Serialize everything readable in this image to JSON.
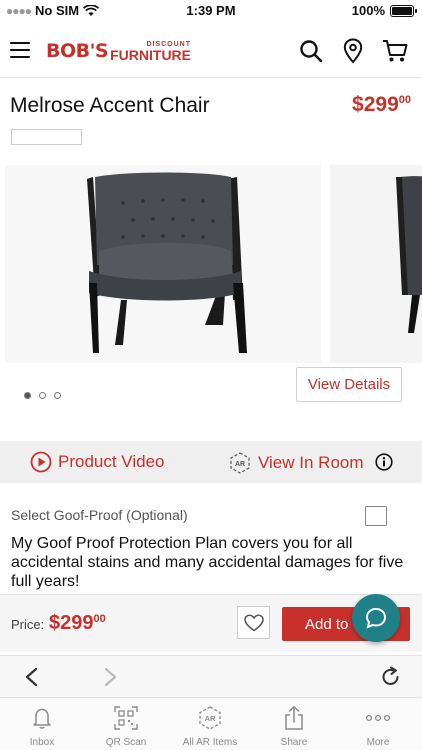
{
  "status": {
    "carrier": "No SIM",
    "time": "1:39 PM",
    "battery": "100%"
  },
  "header": {
    "logo_main": "BOB'S",
    "logo_small": "DISCOUNT",
    "logo_sub": "FURNITURE",
    "icons": [
      "menu-icon",
      "search-icon",
      "location-icon",
      "cart-icon"
    ]
  },
  "product": {
    "title": "Melrose Accent Chair",
    "price_dollars": "$299",
    "price_cents": "00",
    "images_count": 3,
    "active_image": 1,
    "view_details_label": "View Details"
  },
  "media": {
    "product_video_label": "Product Video",
    "view_in_room_label": "View In Room",
    "ar_badge": "AR"
  },
  "goof": {
    "label": "Select Goof-Proof (Optional)",
    "checked": false,
    "description": "My Goof Proof Protection Plan covers you for all accidental stains and many accidental damages for five full years!"
  },
  "buy": {
    "price_label": "Price:",
    "price_dollars": "$299",
    "price_cents": "00",
    "add_label": "Add to"
  },
  "tabs": [
    {
      "label": "Inbox",
      "icon": "bell-icon"
    },
    {
      "label": "QR Scan",
      "icon": "qr-icon"
    },
    {
      "label": "All AR Items",
      "icon": "ar-icon"
    },
    {
      "label": "Share",
      "icon": "share-icon"
    },
    {
      "label": "More",
      "icon": "more-icon"
    }
  ],
  "colors": {
    "brand_red": "#c8312b",
    "chat_teal": "#1f8088"
  }
}
